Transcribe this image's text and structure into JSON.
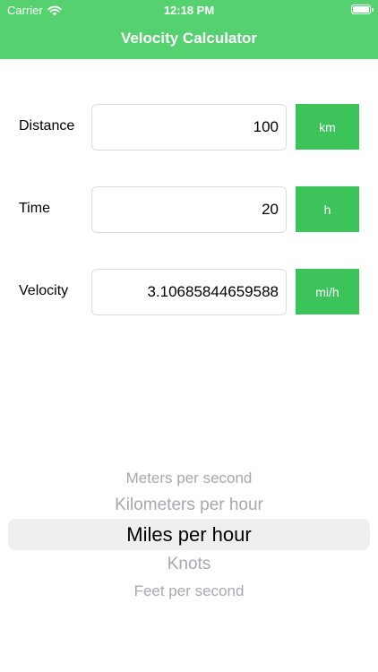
{
  "status_bar": {
    "carrier": "Carrier",
    "time": "12:18 PM",
    "wifi_icon": "wifi-icon",
    "battery_icon": "battery-icon"
  },
  "header": {
    "title": "Velocity Calculator",
    "color": "#55d16f"
  },
  "fields": {
    "distance": {
      "label": "Distance",
      "value": "100",
      "unit": "km"
    },
    "time": {
      "label": "Time",
      "value": "20",
      "unit": "h"
    },
    "velocity": {
      "label": "Velocity",
      "value": "3.10685844659588",
      "unit": "mi/h"
    }
  },
  "unit_button_color": "#3cc45b",
  "picker": {
    "options": [
      "Meters per second",
      "Kilometers per hour",
      "Miles per hour",
      "Knots",
      "Feet per second"
    ],
    "selected": "Miles per hour"
  }
}
